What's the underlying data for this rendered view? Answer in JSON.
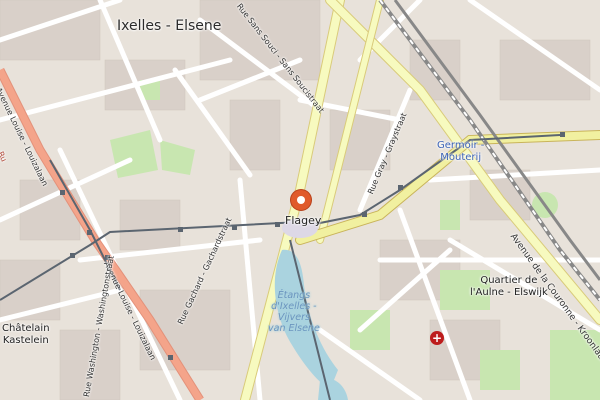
{
  "map": {
    "district_main": "Ixelles - Elsene",
    "district_chatelain": "Châtelain\nKastelein",
    "district_aulne": "Quartier de\nl'Aulne - Elswijk",
    "place_flagey": "Flagey",
    "station_germoir": "Germoir -\nMouterij",
    "water_ponds": "Étangs\nd'Ixelles -\nVijvers\nvan Elsene",
    "street_louise_top": "Avenue Louise - Louizalaan",
    "street_louise_bottom": "Avenue Louise - Louizalaan",
    "street_sans_souci": "Rue Sans Souci - Sans Soucistraat",
    "street_gray": "Rue Gray - Graystraat",
    "street_gachard": "Rue Gachard - Gachardstraat",
    "street_washington": "Rue Washington - Washingtonstraat",
    "street_couronne": "Avenue de la Couronne - Kroonlaan",
    "street_ru": "Ru",
    "pin_icon": "location-pin-icon",
    "hospital_icon": "hospital-cross-icon",
    "hospital_symbol": "+",
    "colors": {
      "background": "#f2efe9",
      "buildings": "#d9d0c9",
      "parks": "#c8e6b0",
      "water": "#aad3df",
      "primary_road": "#f7fabf",
      "trunk_road": "#f4a48a",
      "tram": "#5b6570",
      "railway": "#777777",
      "pin": "#e05a2b"
    }
  }
}
